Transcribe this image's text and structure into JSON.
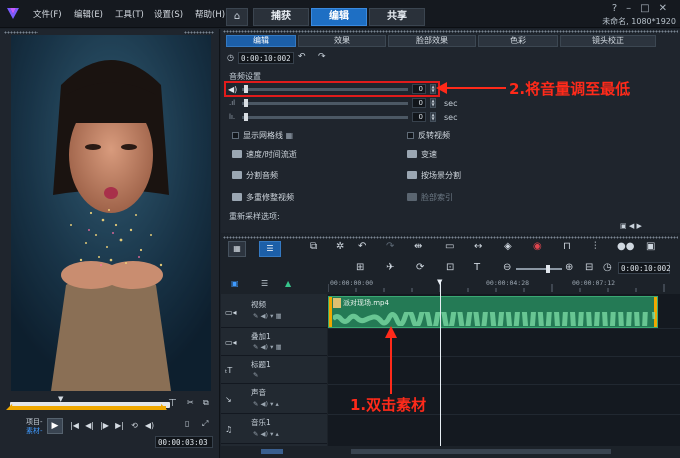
{
  "menu": [
    "文件(F)",
    "编辑(E)",
    "工具(T)",
    "设置(S)",
    "帮助(H)"
  ],
  "main_tabs": [
    {
      "label": "捕获",
      "active": false
    },
    {
      "label": "编辑",
      "active": true
    },
    {
      "label": "共享",
      "active": false
    }
  ],
  "project_info": "未命名, 1080*1920",
  "preview": {
    "project_label": "项目-",
    "clip_label": "素材-",
    "timecode": "00:00:03:03"
  },
  "options": {
    "subtabs": [
      "编辑",
      "效果",
      "脸部效果",
      "色彩",
      "镜头校正"
    ],
    "active_subtab": 0,
    "duration": "0:00:10:002",
    "audio_section": "音频设置",
    "volume": "0",
    "fade_in": "0",
    "fade_out": "0",
    "sec": "sec",
    "items_left": [
      "显示网格线",
      "速度/时间流逝",
      "分割音频",
      "多重修整视频"
    ],
    "items_right": [
      "反转视频",
      "变速",
      "按场景分割",
      "脸部索引"
    ],
    "resample": "重新采样选项:"
  },
  "timeline": {
    "timecode": "0:00:10:002",
    "ruler": [
      "00:00:00:00",
      "00:00:04:28",
      "00:00:07:12"
    ],
    "tracks": [
      "视频",
      "叠加1",
      "标题1",
      "声音",
      "音乐1"
    ],
    "clip_name": "派对现场.mp4"
  },
  "annotations": {
    "step2": "2.将音量调至最低",
    "step1": "1.双击素材"
  },
  "colors": {
    "accent": "#1e6fc4",
    "annotation": "#ff2a1a",
    "clip": "#247a55"
  }
}
